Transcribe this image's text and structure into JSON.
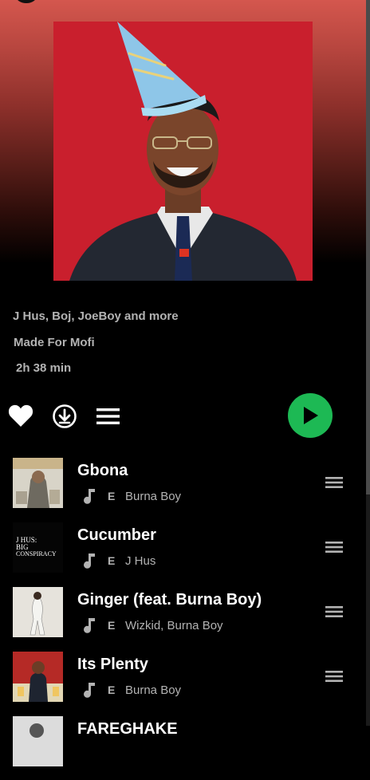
{
  "playlist": {
    "artists_line": "J Hus, Boj, JoeBoy and more",
    "made_for": "Made For Mofi",
    "duration": "2h 38 min"
  },
  "controls": {
    "like_icon": "heart-icon",
    "download_icon": "download-circle-icon",
    "more_icon": "menu-lines-icon",
    "play_icon": "play-icon"
  },
  "colors": {
    "header_gradient_top": "#d4574e",
    "background": "#000000",
    "accent_green": "#1db954",
    "secondary_text": "#b3b3b3",
    "cover_red": "#c91f2d"
  },
  "tracks": [
    {
      "title": "Gbona",
      "explicit": "E",
      "artist": "Burna Boy"
    },
    {
      "title": "Cucumber",
      "explicit": "E",
      "artist": "J Hus"
    },
    {
      "title": "Ginger (feat. Burna Boy)",
      "explicit": "E",
      "artist": "Wizkid, Burna Boy"
    },
    {
      "title": "Its Plenty",
      "explicit": "E",
      "artist": "Burna Boy"
    },
    {
      "title": "FAREGHAKE",
      "explicit": "",
      "artist": ""
    }
  ],
  "thumbs": {
    "cucumber_lines": [
      "J HUS:",
      "BIG",
      "CONSPIRACY"
    ]
  }
}
